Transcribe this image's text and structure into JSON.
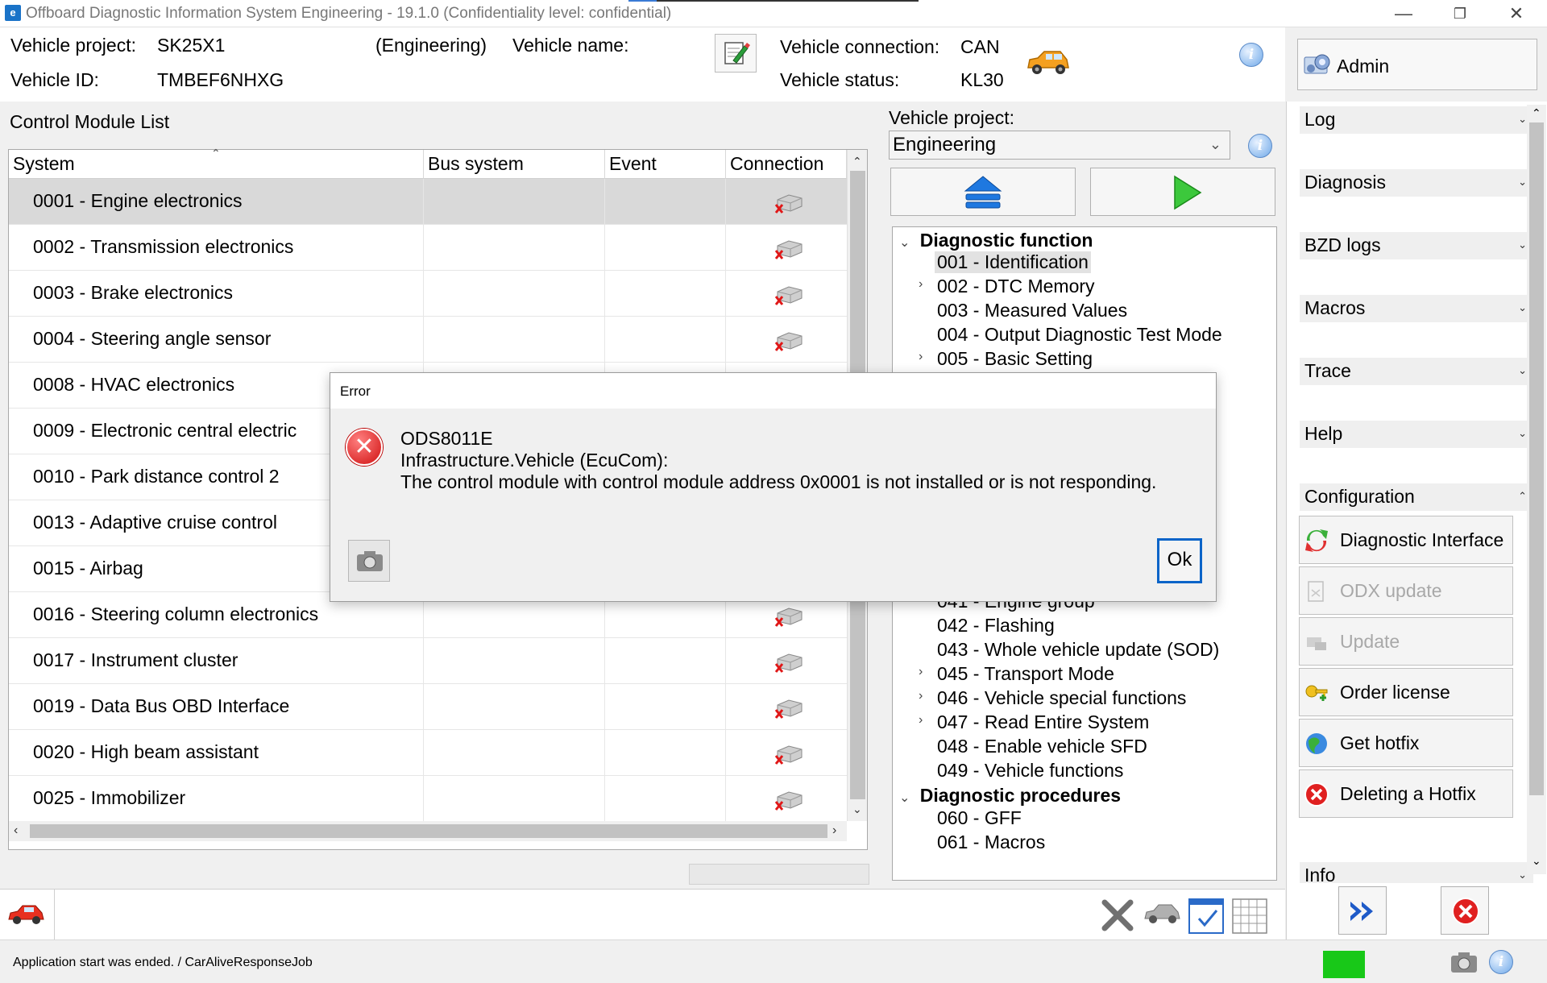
{
  "window": {
    "title": "Offboard Diagnostic Information System Engineering - 19.1.0 (Confidentiality level: confidential)",
    "minimize": "—",
    "restore": "❐",
    "close": "✕"
  },
  "header": {
    "vehicle_project_label": "Vehicle project:",
    "vehicle_project_value": "SK25X1",
    "mode": "(Engineering)",
    "vehicle_name_label": "Vehicle name:",
    "vehicle_id_label": "Vehicle ID:",
    "vehicle_id_value": "TMBEF6NHXG",
    "vehicle_connection_label": "Vehicle connection:",
    "vehicle_connection_value": "CAN",
    "vehicle_status_label": "Vehicle status:",
    "vehicle_status_value": "KL30",
    "user_button": "Admin"
  },
  "control_module_list": {
    "title": "Control Module List",
    "columns": [
      "System",
      "Bus system",
      "Event",
      "Connection"
    ],
    "rows": [
      "0001 - Engine electronics",
      "0002 - Transmission electronics",
      "0003 - Brake electronics",
      "0004 - Steering angle sensor",
      "0008 - HVAC electronics",
      "0009 - Electronic central electric",
      "0010 - Park distance control 2",
      "0013 - Adaptive cruise control",
      "0015 - Airbag",
      "0016 - Steering column electronics",
      "0017 - Instrument cluster",
      "0019 - Data Bus OBD Interface",
      "0020 - High beam assistant",
      "0025 - Immobilizer"
    ]
  },
  "middle": {
    "vehicle_project_label": "Vehicle project:",
    "vehicle_project_select": "Engineering",
    "tree": {
      "group1": "Diagnostic function",
      "items_top": [
        "001 - Identification",
        "002 - DTC Memory",
        "003 - Measured Values",
        "004 - Output Diagnostic Test Mode",
        "005 - Basic Setting"
      ],
      "partial_item": "041 - Engine group",
      "items_bottom": [
        "042 - Flashing",
        "043 - Whole vehicle update (SOD)",
        "045 - Transport Mode",
        "046 - Vehicle special functions",
        "047 - Read Entire System",
        "048 - Enable vehicle SFD",
        "049 - Vehicle functions"
      ],
      "group2": "Diagnostic procedures",
      "items_procedures": [
        "060 - GFF",
        "061 - Macros"
      ]
    }
  },
  "sidebar": {
    "sections": [
      "Log",
      "Diagnosis",
      "BZD logs",
      "Macros",
      "Trace",
      "Help",
      "Configuration"
    ],
    "config_buttons": [
      "Diagnostic Interface",
      "ODX update",
      "Update",
      "Order license",
      "Get hotfix",
      "Deleting a Hotfix"
    ],
    "info_section": "Info"
  },
  "dialog": {
    "title": "Error",
    "code": "ODS8011E",
    "source": "Infrastructure.Vehicle (EcuCom):",
    "message": "The control module with control module address 0x0001 is not installed or is not responding.",
    "ok_label": "Ok"
  },
  "status": {
    "text": "Application start was ended. / CarAliveResponseJob",
    "indicator_color": "#18c818"
  }
}
